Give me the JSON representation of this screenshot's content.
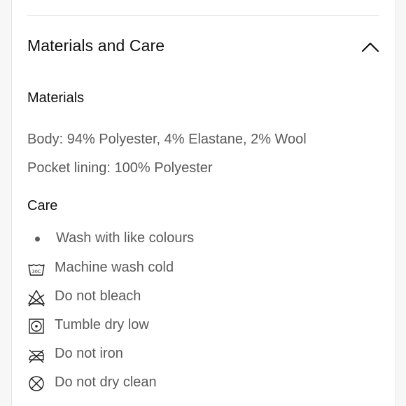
{
  "section": {
    "title": "Materials and Care",
    "expanded": true,
    "toggle_icon": "chevron-up-icon"
  },
  "materials": {
    "heading": "Materials",
    "lines": [
      "Body: 94% Polyester, 4% Elastane, 2% Wool",
      "Pocket lining: 100% Polyester"
    ]
  },
  "care": {
    "heading": "Care",
    "bullet": "Wash with like colours",
    "items": [
      {
        "label": "Machine wash cold",
        "icon": "wash-tub-30c-icon",
        "icon_text": "30C"
      },
      {
        "label": "Do not bleach",
        "icon": "do-not-bleach-icon"
      },
      {
        "label": "Tumble dry low",
        "icon": "tumble-dry-low-icon"
      },
      {
        "label": "Do not iron",
        "icon": "do-not-iron-icon"
      },
      {
        "label": "Do not dry clean",
        "icon": "do-not-dry-clean-icon"
      }
    ]
  },
  "colors": {
    "heading_text": "#111111",
    "body_text": "#5a5a5a",
    "divider": "#e2e2e2"
  }
}
